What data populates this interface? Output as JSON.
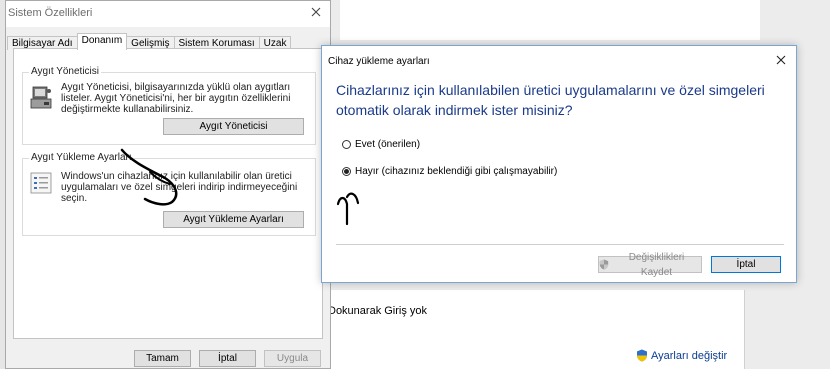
{
  "background": {
    "touch_text": "Dokunarak Giriş yok",
    "change_settings": "Ayarları değiştir"
  },
  "system_properties": {
    "title": "Sistem Özellikleri",
    "tabs": [
      {
        "label": "Bilgisayar Adı",
        "active": false
      },
      {
        "label": "Donanım",
        "active": true
      },
      {
        "label": "Gelişmiş",
        "active": false
      },
      {
        "label": "Sistem Koruması",
        "active": false
      },
      {
        "label": "Uzak",
        "active": false
      }
    ],
    "device_manager": {
      "legend": "Aygıt Yöneticisi",
      "description": "Aygıt Yöneticisi, bilgisayarınızda yüklü olan aygıtları listeler. Aygıt Yöneticisi'ni, her bir aygıtın özelliklerini değiştirmekte kullanabilirsiniz.",
      "button": "Aygıt Yöneticisi"
    },
    "device_install": {
      "legend": "Aygıt Yükleme Ayarları",
      "description": "Windows'un cihazlarınız için kullanılabilir olan üretici uygulamaları ve özel simgeleri indirip indirmeyeceğini seçin.",
      "button": "Aygıt Yükleme Ayarları"
    },
    "ok_button": "Tamam",
    "cancel_button": "İptal",
    "apply_button": "Uygula"
  },
  "dialog": {
    "title": "Cihaz yükleme ayarları",
    "question": "Cihazlarınız için kullanılabilen üretici uygulamalarını ve özel simgeleri otomatik olarak indirmek ister misiniz?",
    "options": [
      {
        "label": "Evet (önerilen)",
        "selected": false
      },
      {
        "label": "Hayır (cihazınız beklendiği gibi çalışmayabilir)",
        "selected": true
      }
    ],
    "save_button": "Değişiklikleri Kaydet",
    "save_enabled": false,
    "cancel_button": "İptal"
  },
  "colors": {
    "accent_blue": "#0078d7",
    "question_text": "#1a3a8a",
    "shield_blue": "#2f6fd0",
    "shield_yellow": "#f2c300"
  }
}
